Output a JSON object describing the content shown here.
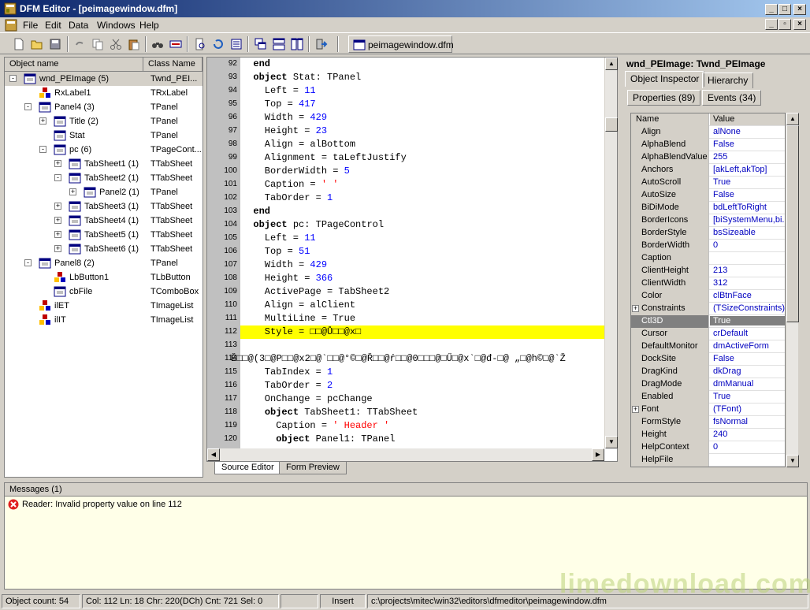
{
  "window": {
    "title": "DFM Editor - [peimagewindow.dfm]"
  },
  "menu": [
    "File",
    "Edit",
    "Data",
    "Windows",
    "Help"
  ],
  "document_tab": "peimagewindow.dfm",
  "tree": {
    "columns": [
      "Object name",
      "Class Name"
    ],
    "rows": [
      {
        "name": "wnd_PEImage (5)",
        "cls": "Twnd_PEI...",
        "exp": "-",
        "icon": "form"
      },
      {
        "name": "RxLabel1",
        "cls": "TRxLabel",
        "exp": "",
        "icon": "component"
      },
      {
        "name": "Panel4 (3)",
        "cls": "TPanel",
        "exp": "-",
        "icon": "panel"
      },
      {
        "name": "Title (2)",
        "cls": "TPanel",
        "exp": "+",
        "icon": "panel"
      },
      {
        "name": "Stat",
        "cls": "TPanel",
        "exp": "",
        "icon": "panel"
      },
      {
        "name": "pc (6)",
        "cls": "TPageCont...",
        "exp": "-",
        "icon": "panel"
      },
      {
        "name": "TabSheet1 (1)",
        "cls": "TTabSheet",
        "exp": "+",
        "icon": "panel"
      },
      {
        "name": "TabSheet2 (1)",
        "cls": "TTabSheet",
        "exp": "-",
        "icon": "panel"
      },
      {
        "name": "Panel2 (1)",
        "cls": "TPanel",
        "exp": "+",
        "icon": "panel"
      },
      {
        "name": "TabSheet3 (1)",
        "cls": "TTabSheet",
        "exp": "+",
        "icon": "panel"
      },
      {
        "name": "TabSheet4 (1)",
        "cls": "TTabSheet",
        "exp": "+",
        "icon": "panel"
      },
      {
        "name": "TabSheet5 (1)",
        "cls": "TTabSheet",
        "exp": "+",
        "icon": "panel"
      },
      {
        "name": "TabSheet6 (1)",
        "cls": "TTabSheet",
        "exp": "+",
        "icon": "panel"
      },
      {
        "name": "Panel8 (2)",
        "cls": "TPanel",
        "exp": "-",
        "icon": "panel"
      },
      {
        "name": "LbButton1",
        "cls": "TLbButton",
        "exp": "",
        "icon": "component"
      },
      {
        "name": "cbFile",
        "cls": "TComboBox",
        "exp": "",
        "icon": "panel"
      },
      {
        "name": "ilET",
        "cls": "TImageList",
        "exp": "",
        "icon": "component"
      },
      {
        "name": "ilIT",
        "cls": "TImageList",
        "exp": "",
        "icon": "component"
      }
    ]
  },
  "editor": {
    "lines": [
      {
        "n": "92",
        "t": "  end"
      },
      {
        "n": "93",
        "t": "  object Stat: TPanel"
      },
      {
        "n": "94",
        "t": "    Left = 11"
      },
      {
        "n": "95",
        "t": "    Top = 417"
      },
      {
        "n": "96",
        "t": "    Width = 429"
      },
      {
        "n": "97",
        "t": "    Height = 23"
      },
      {
        "n": "98",
        "t": "    Align = alBottom"
      },
      {
        "n": "99",
        "t": "    Alignment = taLeftJustify"
      },
      {
        "n": "100",
        "t": "    BorderWidth = 5"
      },
      {
        "n": "101",
        "t": "    Caption = ' '"
      },
      {
        "n": "102",
        "t": "    TabOrder = 1"
      },
      {
        "n": "103",
        "t": "  end"
      },
      {
        "n": "104",
        "t": "  object pc: TPageControl"
      },
      {
        "n": "105",
        "t": "    Left = 11"
      },
      {
        "n": "106",
        "t": "    Top = 51"
      },
      {
        "n": "107",
        "t": "    Width = 429"
      },
      {
        "n": "108",
        "t": "    Height = 366"
      },
      {
        "n": "109",
        "t": "    ActivePage = TabSheet2"
      },
      {
        "n": "110",
        "t": "    Align = alClient"
      },
      {
        "n": "111",
        "t": "    MultiLine = True"
      },
      {
        "n": "112",
        "t": "    Style = □□@Ů□□@x□"
      },
      {
        "n": "113",
        "t": ""
      },
      {
        "n": "114",
        "t": "Ě□□@(3□@P□□@x2□@`□□@°©□@Ř□□@ŕ□□@0□□□@□Ű□@x`□@đ-□@ „□@h©□@`Ž"
      },
      {
        "n": "115",
        "t": "    TabIndex = 1"
      },
      {
        "n": "116",
        "t": "    TabOrder = 2"
      },
      {
        "n": "117",
        "t": "    OnChange = pcChange"
      },
      {
        "n": "118",
        "t": "    object TabSheet1: TTabSheet"
      },
      {
        "n": "119",
        "t": "      Caption = ' Header '"
      },
      {
        "n": "120",
        "t": "      object Panel1: TPanel"
      }
    ],
    "tabs": [
      "Source Editor",
      "Form Preview"
    ]
  },
  "inspector": {
    "title": "wnd_PEImage: Twnd_PEImage",
    "tabs": [
      "Object Inspector",
      "Hierarchy"
    ],
    "subtabs": [
      "Properties (89)",
      "Events (34)"
    ],
    "columns": [
      "Name",
      "Value"
    ],
    "props": [
      {
        "n": "Align",
        "v": "alNone"
      },
      {
        "n": "AlphaBlend",
        "v": "False"
      },
      {
        "n": "AlphaBlendValue",
        "v": "255"
      },
      {
        "n": "Anchors",
        "v": "[akLeft,akTop]"
      },
      {
        "n": "AutoScroll",
        "v": "True"
      },
      {
        "n": "AutoSize",
        "v": "False"
      },
      {
        "n": "BiDiMode",
        "v": "bdLeftToRight"
      },
      {
        "n": "BorderIcons",
        "v": "[biSystemMenu,bi..."
      },
      {
        "n": "BorderStyle",
        "v": "bsSizeable"
      },
      {
        "n": "BorderWidth",
        "v": "0"
      },
      {
        "n": "Caption",
        "v": ""
      },
      {
        "n": "ClientHeight",
        "v": "213"
      },
      {
        "n": "ClientWidth",
        "v": "312"
      },
      {
        "n": "Color",
        "v": "clBtnFace"
      },
      {
        "n": "Constraints",
        "v": "(TSizeConstraints)",
        "plus": true
      },
      {
        "n": "Ctl3D",
        "v": "True",
        "sel": true
      },
      {
        "n": "Cursor",
        "v": "crDefault"
      },
      {
        "n": "DefaultMonitor",
        "v": "dmActiveForm"
      },
      {
        "n": "DockSite",
        "v": "False"
      },
      {
        "n": "DragKind",
        "v": "dkDrag"
      },
      {
        "n": "DragMode",
        "v": "dmManual"
      },
      {
        "n": "Enabled",
        "v": "True"
      },
      {
        "n": "Font",
        "v": "(TFont)",
        "plus": true
      },
      {
        "n": "FormStyle",
        "v": "fsNormal"
      },
      {
        "n": "Height",
        "v": "240"
      },
      {
        "n": "HelpContext",
        "v": "0"
      },
      {
        "n": "HelpFile",
        "v": ""
      }
    ]
  },
  "messages": {
    "header": "Messages (1)",
    "items": [
      "Reader: Invalid property value on line 112"
    ]
  },
  "status": {
    "object_count": "Object count: 54",
    "position": "Col: 112  Ln: 18  Chr: 220(DCh)  Cnt: 721  Sel: 0",
    "mode": "Insert",
    "path": "c:\\projects\\mitec\\win32\\editors\\dfmeditor\\peimagewindow.dfm"
  },
  "watermark": "limedownload.com"
}
